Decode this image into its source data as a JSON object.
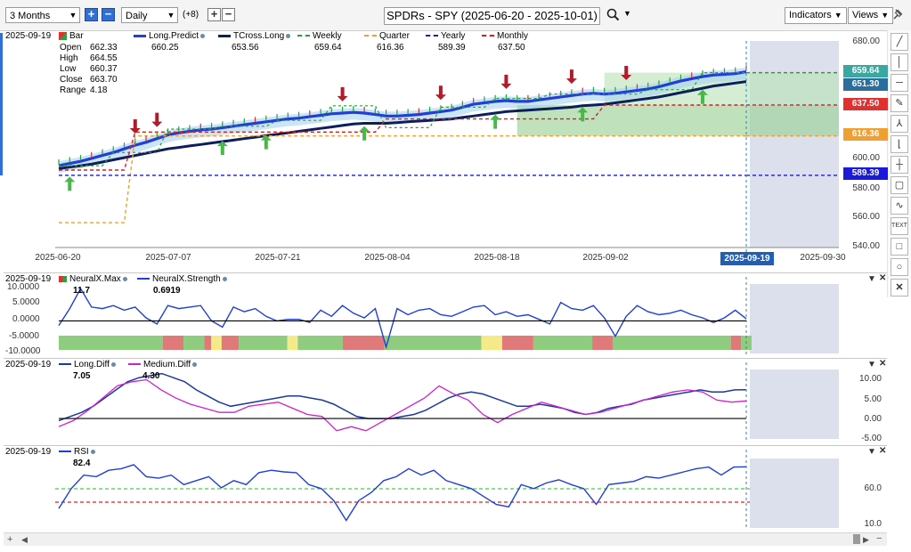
{
  "toolbar": {
    "range": "3 Months",
    "interval": "Daily",
    "offset": "(+8)",
    "title": "SPDRs - SPY (2025-06-20 - 2025-10-01)",
    "indicators_label": "Indicators",
    "views_label": "Views"
  },
  "main_panel": {
    "date": "2025-09-19",
    "bar_label": "Bar",
    "ohlc": {
      "open_label": "Open",
      "open": "662.33",
      "high_label": "High",
      "high": "664.55",
      "low_label": "Low",
      "low": "660.37",
      "close_label": "Close",
      "close": "663.70",
      "range_label": "Range",
      "range": "4.18"
    },
    "legend": [
      {
        "name": "Long.Predict",
        "value": "660.25",
        "color": "#1f3fd8"
      },
      {
        "name": "TCross.Long",
        "value": "653.56",
        "color": "#0b1f5c"
      },
      {
        "name": "Weekly",
        "value": "659.64",
        "color": "#2e9e3c"
      },
      {
        "name": "Quarter",
        "value": "616.36",
        "color": "#f0a030"
      },
      {
        "name": "Yearly",
        "value": "589.39",
        "color": "#1a1ad8"
      },
      {
        "name": "Monthly",
        "value": "637.50",
        "color": "#d81e1e"
      }
    ],
    "price_tags": [
      {
        "value": "659.64",
        "color": "#3aa8a0"
      },
      {
        "value": "651.30",
        "color": "#2a6e9e"
      },
      {
        "value": "637.50",
        "color": "#e03030"
      },
      {
        "value": "616.36",
        "color": "#f0a030"
      },
      {
        "value": "589.39",
        "color": "#1a1ad8"
      }
    ],
    "y_ticks": [
      "680.00",
      "660.00",
      "640.00",
      "620.00",
      "600.00",
      "580.00",
      "560.00",
      "540.00"
    ],
    "x_ticks": [
      "2025-06-20",
      "2025-07-07",
      "2025-07-21",
      "2025-08-04",
      "2025-08-18",
      "2025-09-02",
      "2025-09-30"
    ],
    "cursor_date": "2025-09-19"
  },
  "neuralx_panel": {
    "date": "2025-09-19",
    "legend": [
      {
        "name": "NeuralX.Max",
        "value": "11.7"
      },
      {
        "name": "NeuralX.Strength",
        "value": "0.6919",
        "color": "#1f3fd8"
      }
    ],
    "y_ticks": [
      "10.0000",
      "5.0000",
      "0.0000",
      "-5.0000",
      "-10.0000"
    ]
  },
  "diff_panel": {
    "date": "2025-09-19",
    "legend": [
      {
        "name": "Long.Diff",
        "value": "7.05",
        "color": "#1a3a9e"
      },
      {
        "name": "Medium.Diff",
        "value": "4.30",
        "color": "#d020d0"
      }
    ],
    "y_ticks": [
      "10.00",
      "5.00",
      "0.00",
      "-5.00"
    ]
  },
  "rsi_panel": {
    "date": "2025-09-19",
    "legend": [
      {
        "name": "RSI",
        "value": "82.4",
        "color": "#1f3fd8"
      }
    ],
    "y_ticks": [
      "60.0",
      "10.0"
    ]
  },
  "chart_data": [
    {
      "type": "line",
      "title": "SPDRs - SPY (2025-06-20 - 2025-10-01)",
      "x": [
        "2025-06-20",
        "2025-06-23",
        "2025-06-24",
        "2025-06-25",
        "2025-06-26",
        "2025-06-27",
        "2025-06-30",
        "2025-07-01",
        "2025-07-02",
        "2025-07-03",
        "2025-07-07",
        "2025-07-08",
        "2025-07-09",
        "2025-07-10",
        "2025-07-11",
        "2025-07-14",
        "2025-07-15",
        "2025-07-16",
        "2025-07-17",
        "2025-07-18",
        "2025-07-21",
        "2025-07-22",
        "2025-07-23",
        "2025-07-24",
        "2025-07-25",
        "2025-07-28",
        "2025-07-29",
        "2025-07-30",
        "2025-07-31",
        "2025-08-01",
        "2025-08-04",
        "2025-08-05",
        "2025-08-06",
        "2025-08-07",
        "2025-08-08",
        "2025-08-11",
        "2025-08-12",
        "2025-08-13",
        "2025-08-14",
        "2025-08-15",
        "2025-08-18",
        "2025-08-19",
        "2025-08-20",
        "2025-08-21",
        "2025-08-22",
        "2025-08-25",
        "2025-08-26",
        "2025-08-27",
        "2025-08-28",
        "2025-08-29",
        "2025-09-02",
        "2025-09-03",
        "2025-09-04",
        "2025-09-05",
        "2025-09-08",
        "2025-09-09",
        "2025-09-10",
        "2025-09-11",
        "2025-09-12",
        "2025-09-15",
        "2025-09-16",
        "2025-09-17",
        "2025-09-18",
        "2025-09-19"
      ],
      "series": [
        {
          "name": "Long.Predict",
          "values": [
            596.0,
            597.5,
            599.0,
            601.0,
            603.0,
            605.0,
            607.5,
            610.0,
            612.0,
            614.5,
            617.0,
            618.5,
            619.5,
            620.5,
            621.0,
            622.0,
            623.0,
            624.0,
            625.0,
            626.0,
            627.0,
            628.0,
            628.5,
            629.5,
            630.5,
            631.5,
            632.0,
            632.5,
            632.0,
            631.0,
            630.0,
            630.0,
            630.5,
            631.0,
            632.0,
            633.0,
            634.0,
            636.0,
            638.0,
            639.0,
            640.0,
            640.5,
            640.0,
            640.0,
            641.0,
            642.0,
            643.0,
            644.0,
            645.0,
            645.5,
            645.0,
            645.5,
            646.5,
            647.5,
            648.5,
            650.0,
            652.0,
            654.0,
            655.5,
            657.0,
            658.0,
            658.5,
            659.0,
            660.25
          ]
        },
        {
          "name": "TCross.Long",
          "values": [
            594.0,
            595.0,
            596.0,
            597.0,
            598.5,
            600.0,
            601.5,
            603.0,
            604.5,
            606.0,
            607.5,
            608.5,
            609.5,
            610.5,
            611.5,
            612.5,
            613.5,
            614.5,
            615.5,
            616.5,
            617.5,
            618.5,
            619.5,
            620.5,
            621.5,
            622.5,
            623.5,
            624.5,
            625.0,
            625.0,
            625.0,
            625.5,
            626.0,
            626.5,
            627.0,
            627.5,
            628.0,
            629.0,
            630.0,
            631.0,
            632.0,
            633.0,
            633.5,
            634.0,
            634.5,
            635.0,
            635.5,
            636.0,
            637.0,
            637.5,
            638.0,
            639.0,
            640.0,
            641.0,
            642.0,
            643.0,
            644.5,
            646.0,
            647.5,
            649.0,
            650.5,
            651.5,
            652.5,
            653.56
          ]
        },
        {
          "name": "Weekly",
          "values": [
            596.0,
            596.0,
            596.0,
            596.0,
            596.0,
            605.0,
            605.0,
            605.0,
            605.0,
            605.0,
            621.0,
            621.0,
            621.0,
            621.0,
            621.0,
            623.0,
            623.0,
            623.0,
            623.0,
            623.0,
            627.0,
            627.0,
            627.0,
            627.0,
            627.0,
            637.0,
            637.0,
            637.0,
            637.0,
            637.0,
            622.0,
            622.0,
            622.0,
            622.0,
            622.0,
            636.0,
            636.0,
            636.0,
            636.0,
            636.0,
            642.0,
            642.0,
            642.0,
            642.0,
            642.0,
            645.0,
            645.0,
            645.0,
            645.0,
            645.0,
            645.0,
            645.0,
            645.0,
            645.0,
            648.0,
            648.0,
            648.0,
            648.0,
            648.0,
            659.64,
            659.64,
            659.64,
            659.64,
            659.64
          ]
        },
        {
          "name": "Quarter",
          "values": [
            557.0,
            557.0,
            557.0,
            557.0,
            557.0,
            557.0,
            557.0,
            616.36,
            616.36,
            616.36,
            616.36,
            616.36,
            616.36,
            616.36,
            616.36,
            616.36,
            616.36,
            616.36,
            616.36,
            616.36,
            616.36,
            616.36,
            616.36,
            616.36,
            616.36,
            616.36,
            616.36,
            616.36,
            616.36,
            616.36,
            616.36,
            616.36,
            616.36,
            616.36,
            616.36,
            616.36,
            616.36,
            616.36,
            616.36,
            616.36,
            616.36,
            616.36,
            616.36,
            616.36,
            616.36,
            616.36,
            616.36,
            616.36,
            616.36,
            616.36,
            616.36,
            616.36,
            616.36,
            616.36,
            616.36,
            616.36,
            616.36,
            616.36,
            616.36,
            616.36,
            616.36,
            616.36,
            616.36,
            616.36
          ]
        },
        {
          "name": "Yearly",
          "values": [
            589.39,
            589.39,
            589.39,
            589.39,
            589.39,
            589.39,
            589.39,
            589.39,
            589.39,
            589.39,
            589.39,
            589.39,
            589.39,
            589.39,
            589.39,
            589.39,
            589.39,
            589.39,
            589.39,
            589.39,
            589.39,
            589.39,
            589.39,
            589.39,
            589.39,
            589.39,
            589.39,
            589.39,
            589.39,
            589.39,
            589.39,
            589.39,
            589.39,
            589.39,
            589.39,
            589.39,
            589.39,
            589.39,
            589.39,
            589.39,
            589.39,
            589.39,
            589.39,
            589.39,
            589.39,
            589.39,
            589.39,
            589.39,
            589.39,
            589.39,
            589.39,
            589.39,
            589.39,
            589.39,
            589.39,
            589.39,
            589.39,
            589.39,
            589.39,
            589.39,
            589.39,
            589.39,
            589.39,
            589.39
          ]
        },
        {
          "name": "Monthly",
          "values": [
            593.0,
            593.0,
            593.0,
            593.0,
            593.0,
            593.0,
            593.0,
            619.0,
            619.0,
            619.0,
            619.0,
            619.0,
            619.0,
            619.0,
            619.0,
            619.0,
            619.0,
            619.0,
            619.0,
            619.0,
            619.0,
            619.0,
            619.0,
            619.0,
            619.0,
            619.0,
            619.0,
            619.0,
            619.0,
            619.0,
            628.0,
            628.0,
            628.0,
            628.0,
            628.0,
            628.0,
            628.0,
            628.0,
            628.0,
            628.0,
            628.0,
            628.0,
            628.0,
            628.0,
            628.0,
            628.0,
            628.0,
            628.0,
            628.0,
            628.0,
            637.5,
            637.5,
            637.5,
            637.5,
            637.5,
            637.5,
            637.5,
            637.5,
            637.5,
            637.5,
            637.5,
            637.5,
            637.5,
            637.5
          ]
        }
      ],
      "ylim": [
        540,
        685
      ],
      "grid": false,
      "legend_position": "top-left"
    },
    {
      "type": "line",
      "series": [
        {
          "name": "NeuralX.Strength",
          "values": [
            -1.5,
            4.0,
            10.5,
            4.5,
            4.0,
            5.0,
            3.5,
            4.5,
            1.0,
            -1.0,
            5.0,
            4.0,
            4.5,
            5.0,
            0.0,
            -2.0,
            4.5,
            3.0,
            4.0,
            1.5,
            0.0,
            0.5,
            0.5,
            -0.5,
            3.5,
            1.5,
            5.0,
            2.5,
            1.0,
            4.0,
            -8.5,
            4.0,
            2.0,
            3.5,
            4.0,
            2.0,
            1.5,
            3.0,
            4.5,
            5.0,
            2.0,
            3.0,
            1.5,
            2.0,
            0.5,
            -1.0,
            6.0,
            4.0,
            3.5,
            5.0,
            1.0,
            -5.0,
            1.5,
            5.0,
            3.0,
            2.0,
            2.5,
            3.5,
            2.0,
            1.0,
            -0.5,
            1.0,
            3.5,
            0.69
          ]
        }
      ],
      "ylim": [
        -10,
        12
      ]
    },
    {
      "type": "line",
      "series": [
        {
          "name": "Long.Diff",
          "values": [
            -0.5,
            0.5,
            1.5,
            3.0,
            5.0,
            7.0,
            9.0,
            10.0,
            10.5,
            11.0,
            10.0,
            9.0,
            7.0,
            5.5,
            4.0,
            3.0,
            3.5,
            4.0,
            4.5,
            5.0,
            5.5,
            5.5,
            5.0,
            4.5,
            3.5,
            2.0,
            0.5,
            0.0,
            0.0,
            0.0,
            0.5,
            1.0,
            2.0,
            3.5,
            5.0,
            6.0,
            6.5,
            6.0,
            5.0,
            4.0,
            3.0,
            3.0,
            3.5,
            3.0,
            2.5,
            1.5,
            1.0,
            1.5,
            2.5,
            3.0,
            3.5,
            4.5,
            5.0,
            5.5,
            6.0,
            6.5,
            7.0,
            6.5,
            6.5,
            7.0,
            7.05
          ]
        },
        {
          "name": "Medium.Diff",
          "values": [
            -2.0,
            -0.5,
            2.0,
            5.0,
            8.0,
            9.0,
            9.5,
            7.0,
            5.0,
            3.5,
            2.5,
            1.5,
            1.5,
            3.0,
            3.5,
            4.0,
            2.5,
            1.0,
            0.5,
            -3.0,
            -2.0,
            -3.0,
            -1.0,
            1.0,
            3.0,
            5.0,
            8.0,
            6.0,
            4.5,
            1.0,
            -1.0,
            1.0,
            2.5,
            4.0,
            3.0,
            2.0,
            1.0,
            1.5,
            2.5,
            3.5,
            4.5,
            5.5,
            6.5,
            7.0,
            6.5,
            4.5,
            4.0,
            4.3
          ]
        }
      ],
      "ylim": [
        -5,
        12
      ]
    },
    {
      "type": "line",
      "series": [
        {
          "name": "RSI",
          "values": [
            30,
            55,
            72,
            70,
            78,
            80,
            85,
            70,
            68,
            72,
            60,
            65,
            70,
            56,
            65,
            60,
            75,
            78,
            76,
            75,
            60,
            55,
            40,
            15,
            40,
            50,
            65,
            70,
            80,
            72,
            78,
            65,
            60,
            55,
            45,
            35,
            32,
            60,
            55,
            62,
            66,
            60,
            55,
            35,
            60,
            62,
            64,
            70,
            68,
            72,
            76,
            80,
            82,
            72,
            82,
            82.4
          ]
        }
      ],
      "ylim": [
        10,
        95
      ]
    }
  ]
}
